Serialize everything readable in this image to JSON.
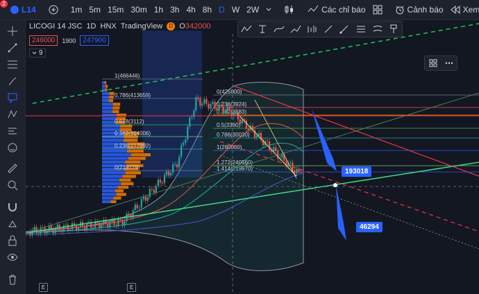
{
  "topbar": {
    "badge_count": "2",
    "symbol": "L14",
    "intervals": [
      "1m",
      "5m",
      "15m",
      "30m",
      "1h",
      "3h",
      "4h",
      "8h",
      "D",
      "W",
      "2W"
    ],
    "active_interval": "D",
    "indicators_label": "Các chỉ báo",
    "alert_label": "Cảnh báo",
    "replay_label": "Xem lại"
  },
  "legend": {
    "name": "LICOGI 14 JSC",
    "timeframe": "1D",
    "exchange": "HNX",
    "source": "TradingView",
    "flag": "D",
    "ohlc_prefix": "O",
    "open": "342000",
    "bid": "246000",
    "spread": "1900",
    "ask": "247900",
    "indicator_count": "9"
  },
  "fib_labels": [
    "1(466446)",
    "0.786(413659)",
    "0.618(3112)",
    "0.382(314006)",
    "0.236(277992)",
    "0(219779)"
  ],
  "fib2_labels": [
    "0(425000)",
    "0.236(3924)",
    "0.382(3583)",
    "0.5(3390)",
    "0.786(30030)",
    "1(280000)",
    "1.272(240560)",
    "1.414(219970)"
  ],
  "callouts": {
    "upper": "193018",
    "lower": "46294"
  },
  "bottom": {
    "e1": "E",
    "e2": "E"
  },
  "colors": {
    "bg": "#131722",
    "up": "#26a69a",
    "down": "#ef5350",
    "accent": "#2962ff"
  }
}
